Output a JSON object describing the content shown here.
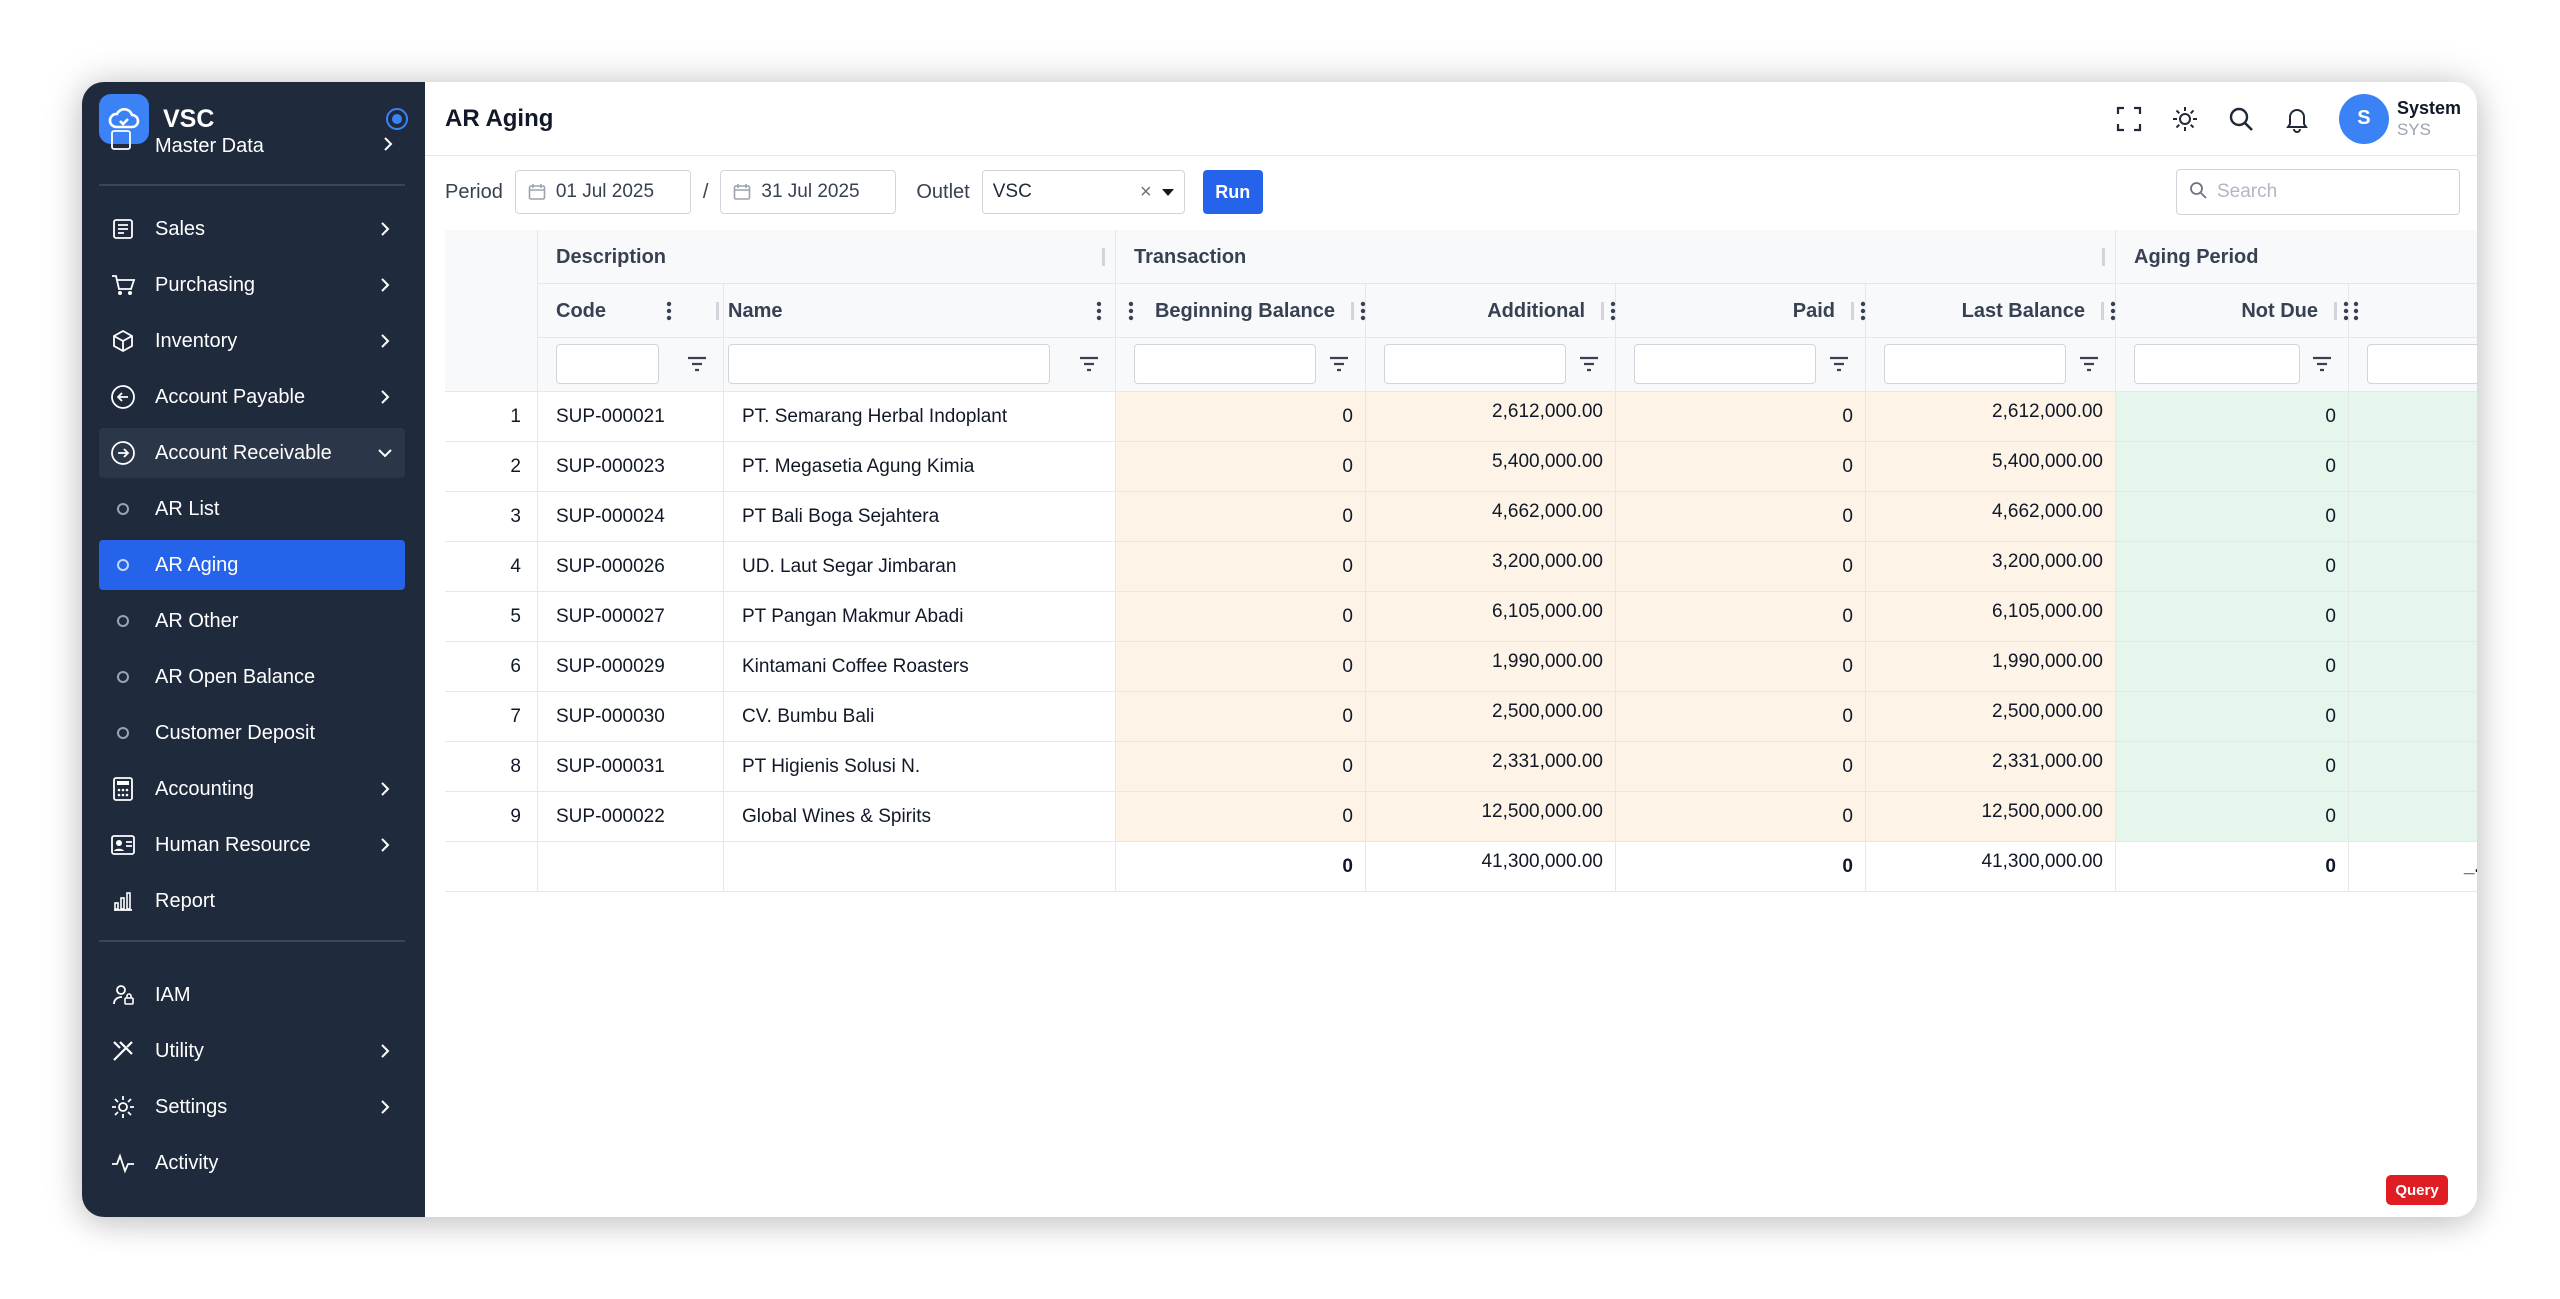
{
  "app": {
    "name": "VSC"
  },
  "sidebar": {
    "top_cut_label": "Master Data",
    "items": [
      {
        "label": "Sales",
        "icon": "sales-icon"
      },
      {
        "label": "Purchasing",
        "icon": "cart-icon"
      },
      {
        "label": "Inventory",
        "icon": "box-icon"
      },
      {
        "label": "Account Payable",
        "icon": "arrow-left-circle-icon"
      },
      {
        "label": "Account Receivable",
        "icon": "arrow-right-circle-icon"
      }
    ],
    "sub_items": [
      {
        "label": "AR List"
      },
      {
        "label": "AR Aging"
      },
      {
        "label": "AR Other"
      },
      {
        "label": "AR Open Balance"
      },
      {
        "label": "Customer Deposit"
      }
    ],
    "items2": [
      {
        "label": "Accounting",
        "icon": "calculator-icon"
      },
      {
        "label": "Human Resource",
        "icon": "id-card-icon"
      },
      {
        "label": "Report",
        "icon": "bar-chart-icon"
      }
    ],
    "items3": [
      {
        "label": "IAM",
        "icon": "user-lock-icon"
      },
      {
        "label": "Utility",
        "icon": "tools-icon"
      },
      {
        "label": "Settings",
        "icon": "gear-icon"
      },
      {
        "label": "Activity",
        "icon": "activity-icon"
      }
    ]
  },
  "header": {
    "title": "AR Aging",
    "user": {
      "initial": "S",
      "name": "System",
      "code": "SYS"
    }
  },
  "filters": {
    "period_label": "Period",
    "date_from": "01 Jul 2025",
    "date_separator": "/",
    "date_to": "31 Jul 2025",
    "outlet_label": "Outlet",
    "outlet_value": "VSC",
    "clear_glyph": "×",
    "run_label": "Run",
    "search_placeholder": "Search"
  },
  "table": {
    "groups": {
      "description": "Description",
      "transaction": "Transaction",
      "aging": "Aging Period"
    },
    "columns": {
      "code": "Code",
      "name": "Name",
      "beginning": "Beginning Balance",
      "additional": "Additional",
      "paid": "Paid",
      "last": "Last Balance",
      "not_due": "Not Due"
    },
    "rows": [
      {
        "no": "1",
        "code": "SUP-000021",
        "name": "PT. Semarang Herbal Indoplant",
        "beginning": "0",
        "additional": "2,612,000.00",
        "paid": "0",
        "last": "2,612,000.00",
        "not_due": "0"
      },
      {
        "no": "2",
        "code": "SUP-000023",
        "name": "PT. Megasetia Agung Kimia",
        "beginning": "0",
        "additional": "5,400,000.00",
        "paid": "0",
        "last": "5,400,000.00",
        "not_due": "0"
      },
      {
        "no": "3",
        "code": "SUP-000024",
        "name": "PT Bali Boga Sejahtera",
        "beginning": "0",
        "additional": "4,662,000.00",
        "paid": "0",
        "last": "4,662,000.00",
        "not_due": "0"
      },
      {
        "no": "4",
        "code": "SUP-000026",
        "name": "UD. Laut Segar Jimbaran",
        "beginning": "0",
        "additional": "3,200,000.00",
        "paid": "0",
        "last": "3,200,000.00",
        "not_due": "0"
      },
      {
        "no": "5",
        "code": "SUP-000027",
        "name": "PT Pangan Makmur Abadi",
        "beginning": "0",
        "additional": "6,105,000.00",
        "paid": "0",
        "last": "6,105,000.00",
        "not_due": "0"
      },
      {
        "no": "6",
        "code": "SUP-000029",
        "name": "Kintamani Coffee Roasters",
        "beginning": "0",
        "additional": "1,990,000.00",
        "paid": "0",
        "last": "1,990,000.00",
        "not_due": "0"
      },
      {
        "no": "7",
        "code": "SUP-000030",
        "name": "CV. Bumbu Bali",
        "beginning": "0",
        "additional": "2,500,000.00",
        "paid": "0",
        "last": "2,500,000.00",
        "not_due": "0"
      },
      {
        "no": "8",
        "code": "SUP-000031",
        "name": "PT Higienis Solusi N.",
        "beginning": "0",
        "additional": "2,331,000.00",
        "paid": "0",
        "last": "2,331,000.00",
        "not_due": "0"
      },
      {
        "no": "9",
        "code": "SUP-000022",
        "name": "Global Wines & Spirits",
        "beginning": "0",
        "additional": "12,500,000.00",
        "paid": "0",
        "last": "12,500,000.00",
        "not_due": "0"
      }
    ],
    "totals": {
      "beginning": "0",
      "additional": "41,300,000.00",
      "paid": "0",
      "last": "41,300,000.00",
      "not_due": "0",
      "next_cut": "_.,"
    }
  },
  "footer": {
    "query_label": "Query"
  },
  "colors": {
    "sidebar_bg": "#1f2a3c",
    "accent": "#2563eb",
    "transaction_bg": "#fdf4e7",
    "aging_bg": "#e6f6ec",
    "query_bg": "#e11d24"
  }
}
